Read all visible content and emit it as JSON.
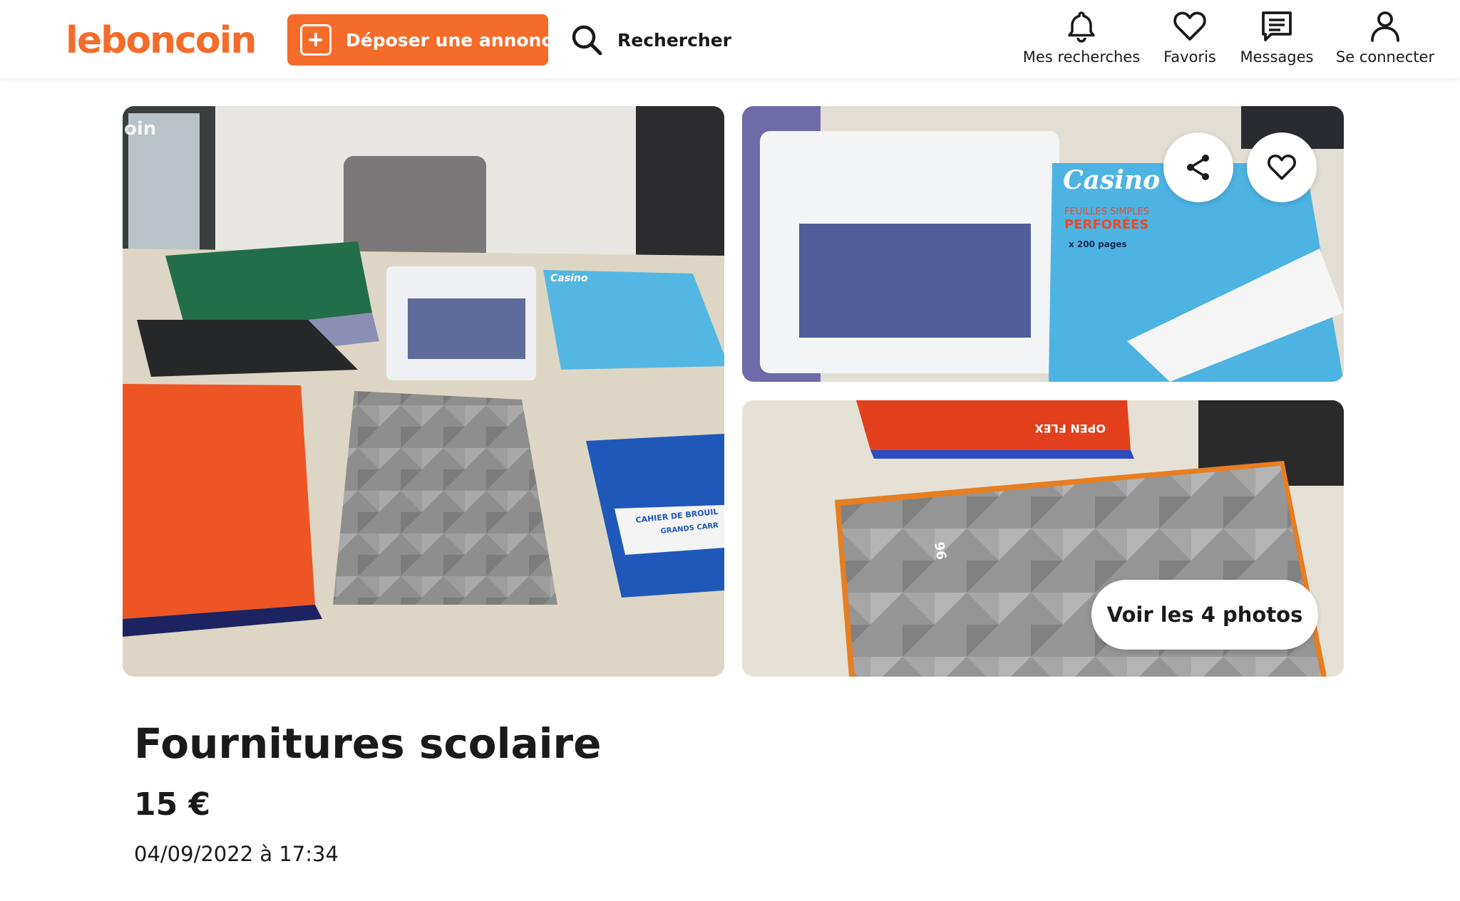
{
  "header": {
    "logo": "leboncoin",
    "post_button": "Déposer une annonce",
    "search_label": "Rechercher",
    "nav": [
      {
        "label": "Mes recherches",
        "icon": "bell-icon"
      },
      {
        "label": "Favoris",
        "icon": "heart-icon"
      },
      {
        "label": "Messages",
        "icon": "message-icon"
      },
      {
        "label": "Se connecter",
        "icon": "user-icon"
      }
    ]
  },
  "gallery": {
    "see_all_label": "Voir les 4 photos",
    "share_icon": "share-icon",
    "favorite_icon": "heart-icon",
    "watermark": "oin",
    "photo_texts": {
      "paper_pack_brand": "Casino",
      "paper_pack_line1": "FEUILLES SIMPLES",
      "paper_pack_line2": "PERFORÉES",
      "paper_pack_count": "x 200 pages",
      "notebook_label1": "CAHIER DE BROUIL",
      "notebook_label2": "GRANDS CARR",
      "folder_brand_mirrored": "OPEN FLEX",
      "cover_number": "96"
    }
  },
  "listing": {
    "title": "Fournitures scolaire",
    "price": "15 €",
    "date": "04/09/2022 à 17:34"
  },
  "colors": {
    "brand": "#f56b2a",
    "text": "#1a1a1a"
  }
}
